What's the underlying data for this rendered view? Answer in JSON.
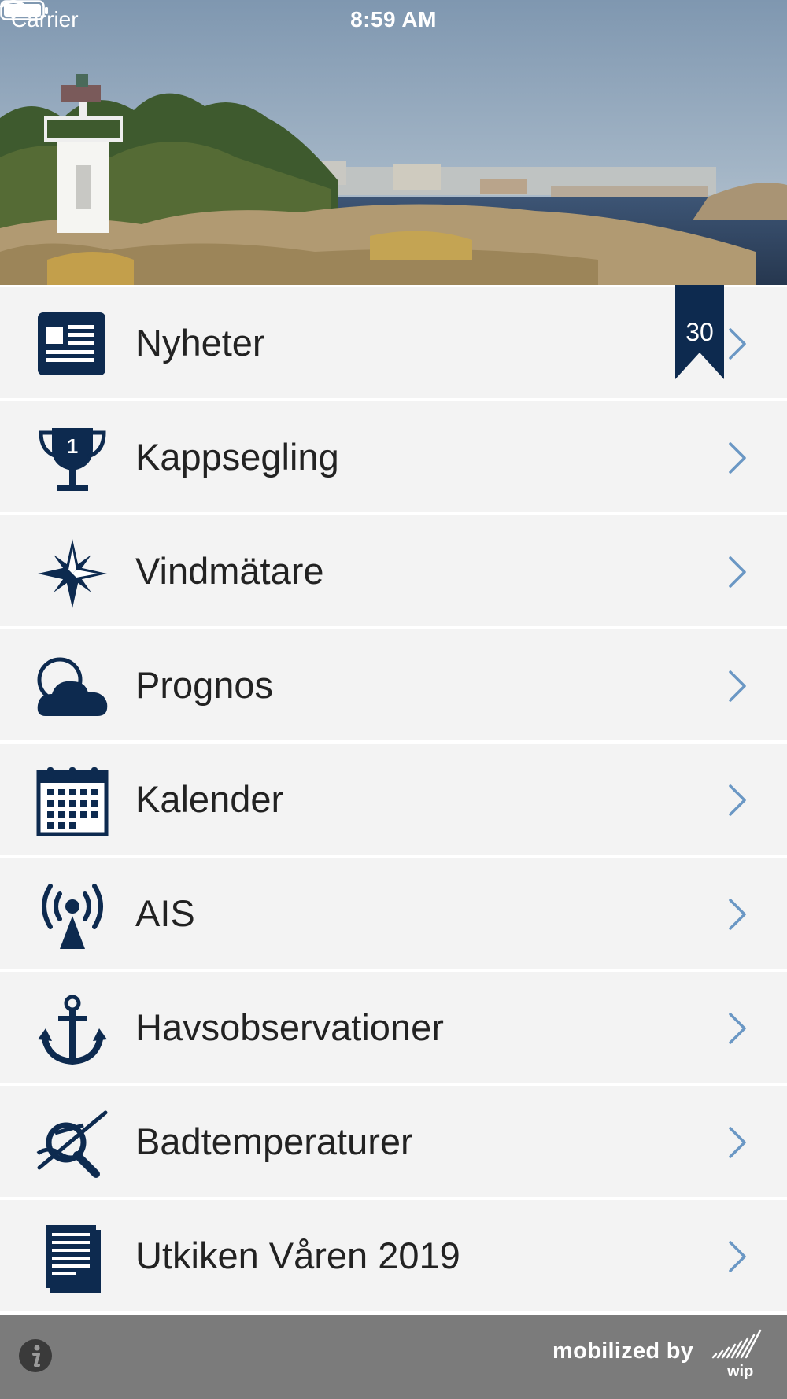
{
  "status_bar": {
    "carrier": "Carrier",
    "time": "8:59 AM"
  },
  "colors": {
    "icon_navy": "#0d2a4f",
    "chevron_blue": "#6a97c4",
    "row_bg": "#f3f3f3",
    "footer_bg": "#7b7b7b"
  },
  "menu": {
    "items": [
      {
        "label": "Nyheter",
        "icon": "newspaper-icon",
        "badge": "30"
      },
      {
        "label": "Kappsegling",
        "icon": "trophy-icon"
      },
      {
        "label": "Vindmätare",
        "icon": "compass-rose-icon"
      },
      {
        "label": "Prognos",
        "icon": "cloud-icon"
      },
      {
        "label": "Kalender",
        "icon": "calendar-icon"
      },
      {
        "label": "AIS",
        "icon": "broadcast-icon"
      },
      {
        "label": "Havsobservationer",
        "icon": "anchor-icon"
      },
      {
        "label": "Badtemperaturer",
        "icon": "no-swimming-icon"
      },
      {
        "label": "Utkiken Våren 2019",
        "icon": "document-icon"
      }
    ]
  },
  "footer": {
    "mobilized_by": "mobilized by",
    "logo_text": "wip"
  }
}
